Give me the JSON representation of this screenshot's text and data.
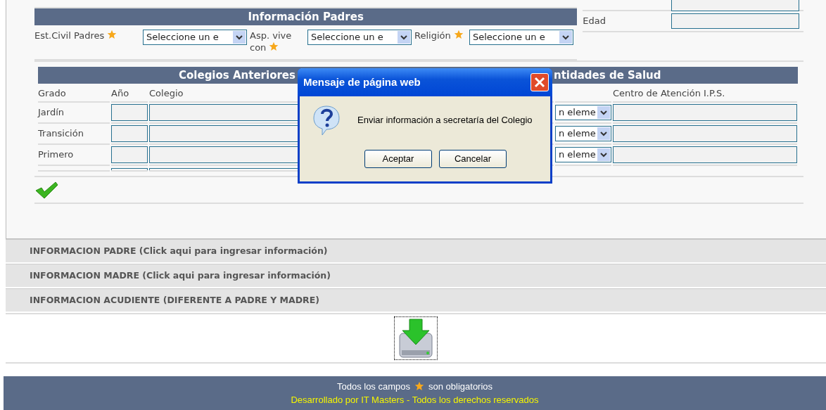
{
  "parents_section": {
    "title": "Información Padres",
    "fields": [
      {
        "label": "Est.Civil Padres",
        "required": true,
        "value": "Seleccione un e"
      },
      {
        "label": "Asp. vive con",
        "required": true,
        "value": "Seleccione un e"
      },
      {
        "label": "Religión",
        "required": true,
        "value": "Seleccione un e"
      }
    ]
  },
  "side_fields": [
    {
      "kind": "cut"
    },
    {
      "kind": "field",
      "label": "Edad"
    }
  ],
  "previous_schools": {
    "title": "Colegios Anteriores",
    "columns": [
      "Grado",
      "Año",
      "Colegio"
    ],
    "rows": [
      {
        "grade": "Jardín"
      },
      {
        "grade": "Transición"
      },
      {
        "grade": "Primero"
      }
    ]
  },
  "health": {
    "title": "ntidades de Salud",
    "columns": [
      "Centro de Atención I.P.S."
    ],
    "rows": [
      {
        "select": "n eleme"
      },
      {
        "select": "n eleme"
      },
      {
        "select": "n eleme"
      }
    ]
  },
  "accordion": [
    "INFORMACION PADRE (Click aqui para ingresar información)",
    "INFORMACION MADRE (Click aqui para ingresar información)",
    "INFORMACION ACUDIENTE (DIFERENTE A PADRE Y MADRE)"
  ],
  "dialog": {
    "title": "Mensaje de página web",
    "message": "Enviar información a secretaría del Colegio",
    "buttons": [
      "Aceptar",
      "Cancelar"
    ]
  },
  "footer": {
    "note_before": "Todos los campos",
    "note_after": "son obligatorios",
    "credit": "Desarrollado por IT Masters - Todos los derechos reservados"
  }
}
